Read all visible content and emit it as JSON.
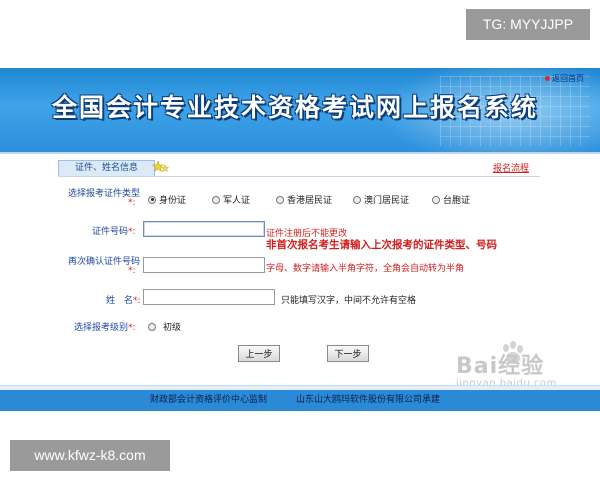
{
  "watermarks": {
    "top": "TG: MYYJJPP",
    "bottom": "www.kfwz-k8.com"
  },
  "header": {
    "title": "全国会计专业技术资格考试网上报名系统",
    "back_link": "返回首页"
  },
  "tab": {
    "label": "证件、姓名信息",
    "flow_link": "报名流程"
  },
  "form": {
    "id_type": {
      "label": "选择报考证件类型",
      "required_mark": "*:",
      "options": [
        "身份证",
        "军人证",
        "香港居民证",
        "澳门居民证",
        "台胞证"
      ],
      "selected_index": 0
    },
    "id_number": {
      "label": "证件号码",
      "required_mark": "*:",
      "value": "",
      "note_top": "证件注册后不能更改",
      "note_bold": "非首次报名考生请输入上次报考的证件类型、号码"
    },
    "confirm_id": {
      "label": "再次确认证件号码",
      "required_mark": "*:",
      "value": "",
      "note": "字母、数字请输入半角字符，全角会自动转为半角"
    },
    "name": {
      "label": "姓　名",
      "required_mark": "*:",
      "value": "",
      "note": "只能填写汉字，中间不允许有空格"
    },
    "level": {
      "label": "选择报考级别",
      "required_mark": "*:",
      "options": [
        "初级"
      ],
      "selected_index": -1
    }
  },
  "buttons": {
    "prev": "上一步",
    "next": "下一步"
  },
  "baidu_watermark": {
    "mark": "Bai经验",
    "sub": "jingyan.baidu.com"
  },
  "footer": {
    "left": "财政部会计资格评价中心监制",
    "right": "山东山大鸥玛软件股份有限公司承建"
  },
  "colors": {
    "banner": "#2b8fdb",
    "label_blue": "#1f4aa0",
    "required_red": "#d01e1e",
    "footer": "#2b8ad6"
  }
}
